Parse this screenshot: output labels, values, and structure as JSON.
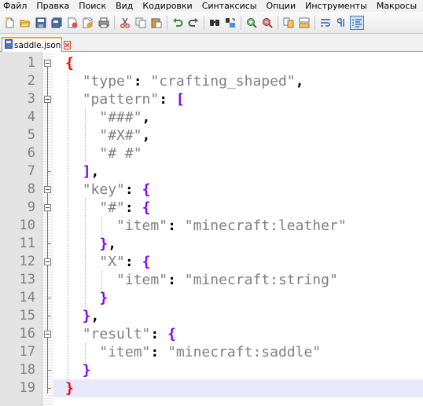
{
  "menu": {
    "items": [
      "Файл",
      "Правка",
      "Поиск",
      "Вид",
      "Кодировки",
      "Синтаксисы",
      "Опции",
      "Инструменты",
      "Макросы"
    ]
  },
  "tab": {
    "filename": "saddle.json"
  },
  "editor": {
    "lines": [
      {
        "num": "1",
        "parts": [
          {
            "t": "{",
            "c": "brred"
          }
        ]
      },
      {
        "num": "2",
        "parts": [
          {
            "t": "  ",
            "c": "ind"
          },
          {
            "t": "\"type\"",
            "c": "str"
          },
          {
            "t": ": ",
            "c": "pn"
          },
          {
            "t": "\"crafting_shaped\"",
            "c": "str"
          },
          {
            "t": ",",
            "c": "pn"
          }
        ]
      },
      {
        "num": "3",
        "parts": [
          {
            "t": "  ",
            "c": "ind"
          },
          {
            "t": "\"pattern\"",
            "c": "str"
          },
          {
            "t": ": ",
            "c": "pn"
          },
          {
            "t": "[",
            "c": "br"
          }
        ]
      },
      {
        "num": "4",
        "parts": [
          {
            "t": "    ",
            "c": "ind"
          },
          {
            "t": "\"###\"",
            "c": "str"
          },
          {
            "t": ",",
            "c": "pn"
          }
        ]
      },
      {
        "num": "5",
        "parts": [
          {
            "t": "    ",
            "c": "ind"
          },
          {
            "t": "\"#X#\"",
            "c": "str"
          },
          {
            "t": ",",
            "c": "pn"
          }
        ]
      },
      {
        "num": "6",
        "parts": [
          {
            "t": "    ",
            "c": "ind"
          },
          {
            "t": "\"# #\"",
            "c": "str"
          }
        ]
      },
      {
        "num": "7",
        "parts": [
          {
            "t": "  ",
            "c": "ind"
          },
          {
            "t": "]",
            "c": "br"
          },
          {
            "t": ",",
            "c": "pn"
          }
        ]
      },
      {
        "num": "8",
        "parts": [
          {
            "t": "  ",
            "c": "ind"
          },
          {
            "t": "\"key\"",
            "c": "str"
          },
          {
            "t": ": ",
            "c": "pn"
          },
          {
            "t": "{",
            "c": "br"
          }
        ]
      },
      {
        "num": "9",
        "parts": [
          {
            "t": "    ",
            "c": "ind"
          },
          {
            "t": "\"#\"",
            "c": "str"
          },
          {
            "t": ": ",
            "c": "pn"
          },
          {
            "t": "{",
            "c": "br"
          }
        ]
      },
      {
        "num": "10",
        "parts": [
          {
            "t": "      ",
            "c": "ind"
          },
          {
            "t": "\"item\"",
            "c": "str"
          },
          {
            "t": ": ",
            "c": "pn"
          },
          {
            "t": "\"minecraft:leather\"",
            "c": "str"
          }
        ]
      },
      {
        "num": "11",
        "parts": [
          {
            "t": "    ",
            "c": "ind"
          },
          {
            "t": "}",
            "c": "br"
          },
          {
            "t": ",",
            "c": "pn"
          }
        ]
      },
      {
        "num": "12",
        "parts": [
          {
            "t": "    ",
            "c": "ind"
          },
          {
            "t": "\"X\"",
            "c": "str"
          },
          {
            "t": ": ",
            "c": "pn"
          },
          {
            "t": "{",
            "c": "br"
          }
        ]
      },
      {
        "num": "13",
        "parts": [
          {
            "t": "      ",
            "c": "ind"
          },
          {
            "t": "\"item\"",
            "c": "str"
          },
          {
            "t": ": ",
            "c": "pn"
          },
          {
            "t": "\"minecraft:string\"",
            "c": "str"
          }
        ]
      },
      {
        "num": "14",
        "parts": [
          {
            "t": "    ",
            "c": "ind"
          },
          {
            "t": "}",
            "c": "br"
          }
        ]
      },
      {
        "num": "15",
        "parts": [
          {
            "t": "  ",
            "c": "ind"
          },
          {
            "t": "}",
            "c": "br"
          },
          {
            "t": ",",
            "c": "pn"
          }
        ]
      },
      {
        "num": "16",
        "parts": [
          {
            "t": "  ",
            "c": "ind"
          },
          {
            "t": "\"result\"",
            "c": "str"
          },
          {
            "t": ": ",
            "c": "pn"
          },
          {
            "t": "{",
            "c": "br"
          }
        ]
      },
      {
        "num": "17",
        "parts": [
          {
            "t": "    ",
            "c": "ind"
          },
          {
            "t": "\"item\"",
            "c": "str"
          },
          {
            "t": ": ",
            "c": "pn"
          },
          {
            "t": "\"minecraft:saddle\"",
            "c": "str"
          }
        ]
      },
      {
        "num": "18",
        "parts": [
          {
            "t": "  ",
            "c": "ind"
          },
          {
            "t": "}",
            "c": "br"
          }
        ]
      },
      {
        "num": "19",
        "parts": [
          {
            "t": "}",
            "c": "brred"
          }
        ]
      }
    ]
  },
  "toolbar": {
    "icons": [
      "new-file-icon",
      "open-file-icon",
      "save-icon",
      "save-all-icon",
      "close-icon",
      "close-all-icon",
      "print-icon",
      "cut-icon",
      "copy-icon",
      "paste-icon",
      "undo-icon",
      "redo-icon",
      "find-icon",
      "replace-icon",
      "zoom-in-icon",
      "zoom-out-icon",
      "sync-vertical-icon",
      "sync-horizontal-icon",
      "word-wrap-icon",
      "show-all-characters-icon",
      "indent-guide-icon"
    ]
  },
  "colors": {
    "string": "#808080",
    "bracket": "#8000ff",
    "root_bracket": "#ff0000",
    "current_line": "#e8e8ff",
    "tab_accent": "#f5a623"
  }
}
